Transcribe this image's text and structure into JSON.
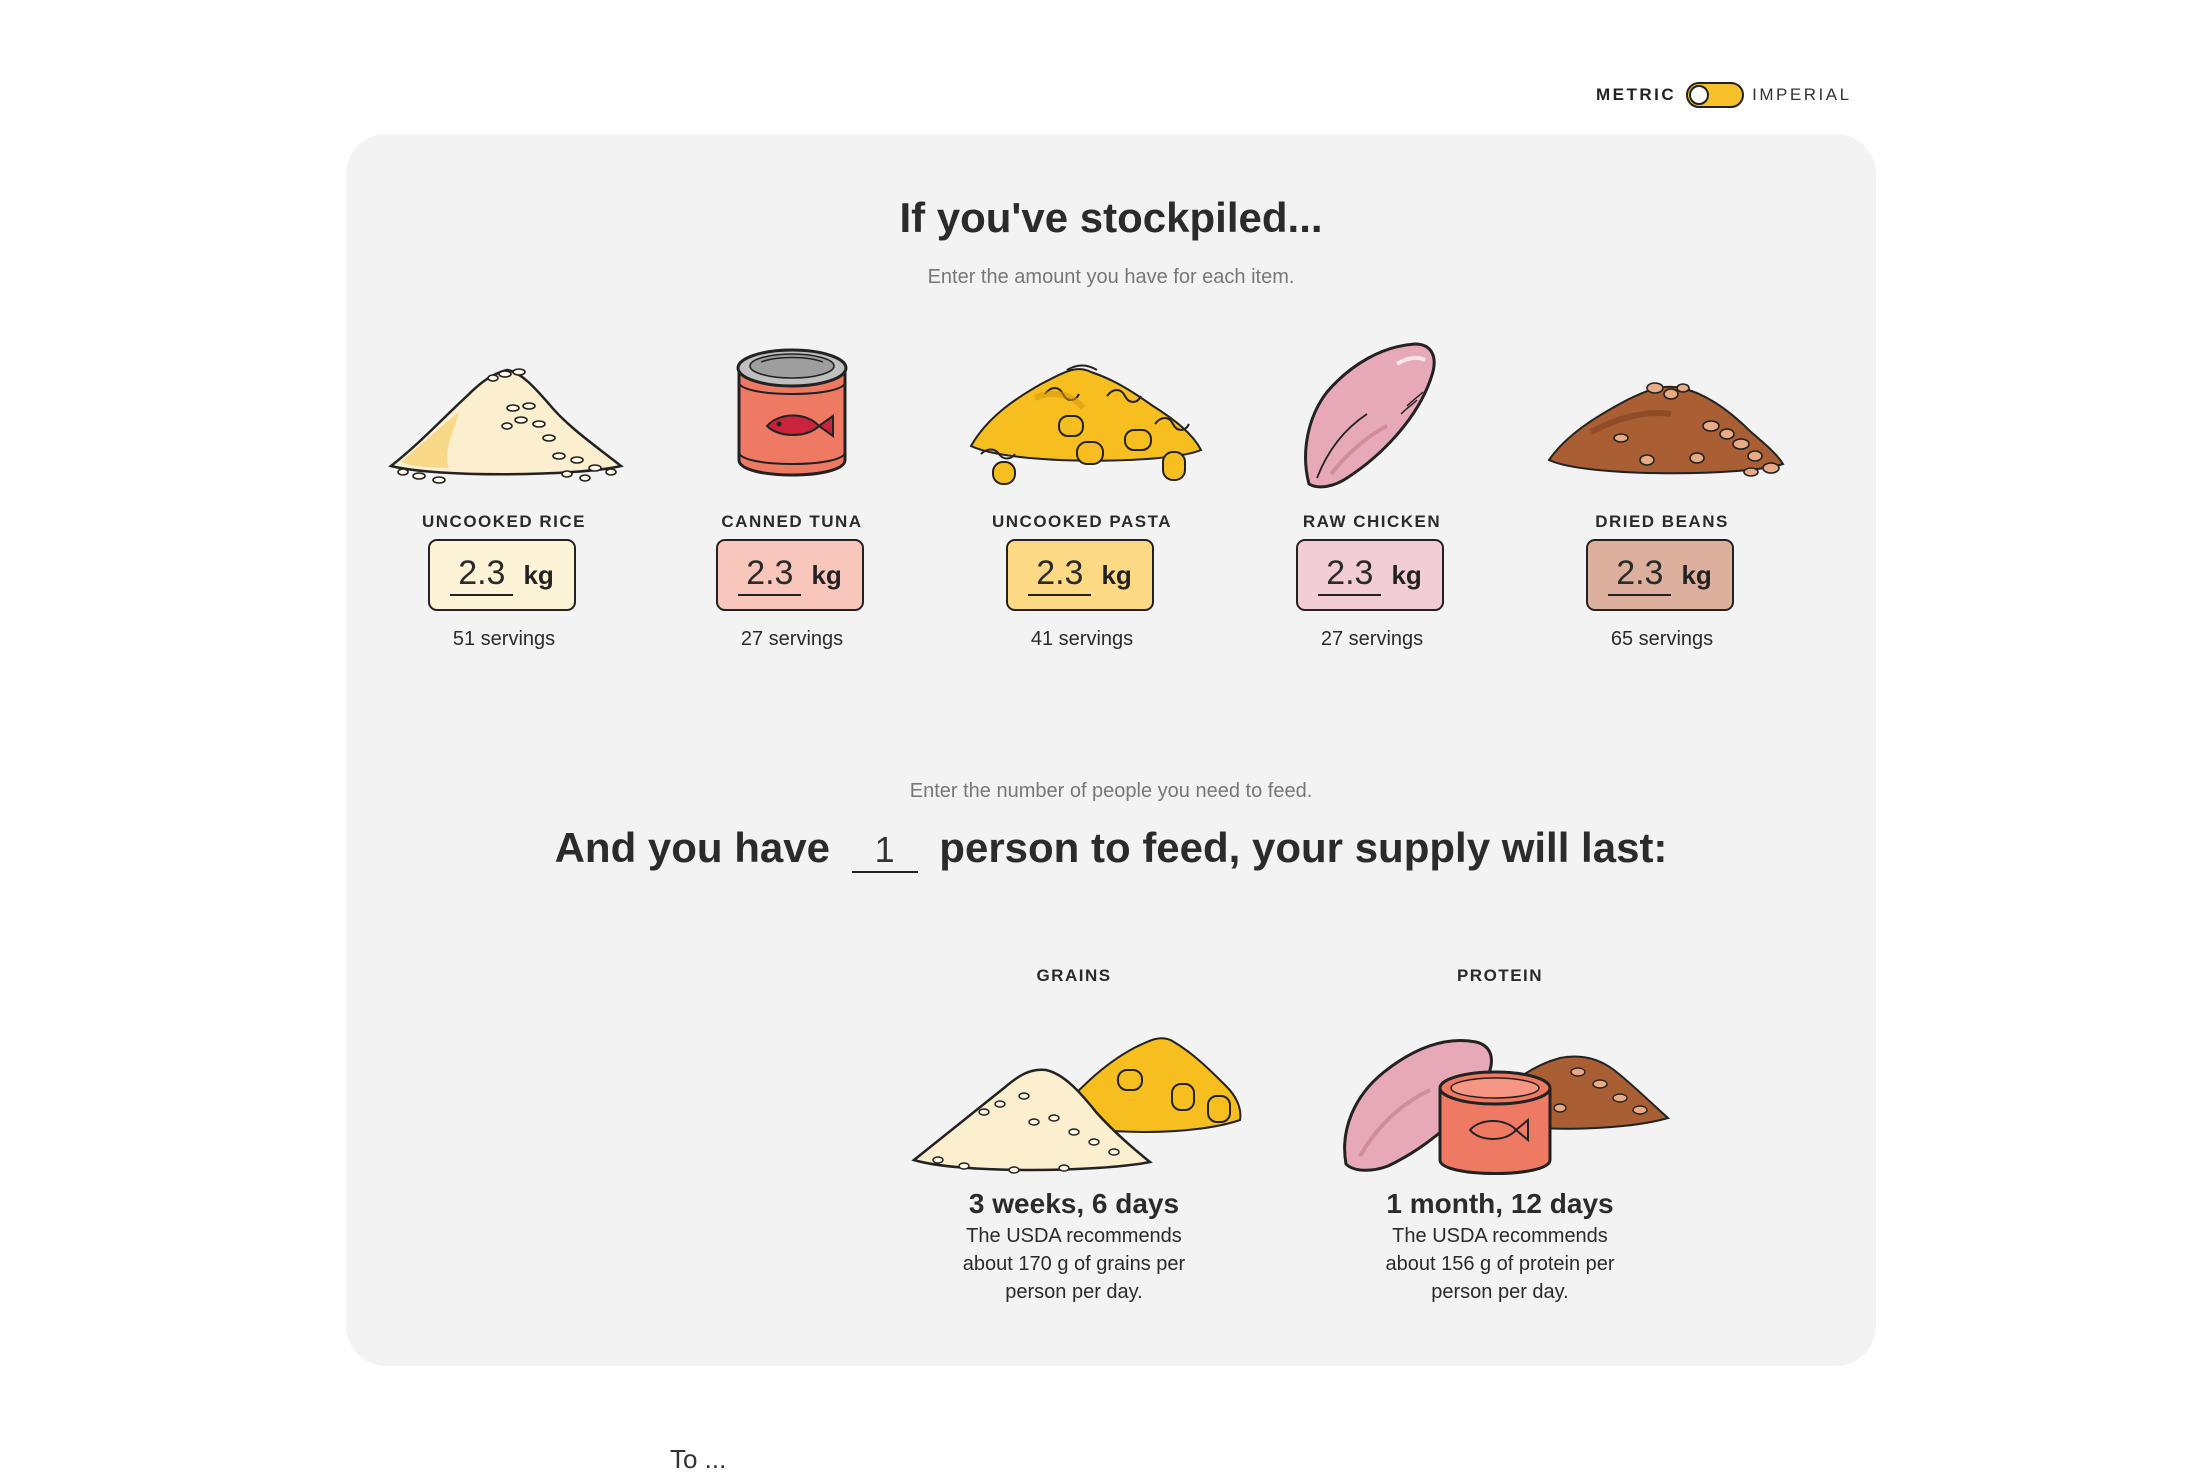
{
  "toggle": {
    "metric_label": "METRIC",
    "imperial_label": "IMPERIAL",
    "selected": "metric"
  },
  "header": {
    "title": "If you've stockpiled...",
    "subtitle": "Enter the amount you have for each item."
  },
  "items": [
    {
      "name": "UNCOOKED RICE",
      "value": "2.3",
      "unit": "kg",
      "servings": "51 servings",
      "box_color": "#fdf3d6",
      "icon": "rice-pile-icon"
    },
    {
      "name": "CANNED TUNA",
      "value": "2.3",
      "unit": "kg",
      "servings": "27 servings",
      "box_color": "#f9c6bb",
      "icon": "tuna-can-icon"
    },
    {
      "name": "UNCOOKED PASTA",
      "value": "2.3",
      "unit": "kg",
      "servings": "41 servings",
      "box_color": "#fbd985",
      "icon": "pasta-pile-icon"
    },
    {
      "name": "RAW CHICKEN",
      "value": "2.3",
      "unit": "kg",
      "servings": "27 servings",
      "box_color": "#f3cdd6",
      "icon": "chicken-breast-icon"
    },
    {
      "name": "DRIED BEANS",
      "value": "2.3",
      "unit": "kg",
      "servings": "65 servings",
      "box_color": "#ddb09e",
      "icon": "beans-pile-icon"
    }
  ],
  "people": {
    "hint": "Enter the number of people you need to feed.",
    "prefix": "And you have",
    "count": "1",
    "suffix": "person to feed, your supply will last:"
  },
  "results": [
    {
      "label": "GRAINS",
      "duration": "3 weeks, 6 days",
      "note": "The USDA recommends about 170 g of grains per person per day.",
      "icon": "grains-group-icon"
    },
    {
      "label": "PROTEIN",
      "duration": "1 month, 12 days",
      "note": "The USDA recommends about 156 g of protein per person per day.",
      "icon": "protein-group-icon"
    }
  ],
  "footer": {
    "text": "To ..."
  }
}
